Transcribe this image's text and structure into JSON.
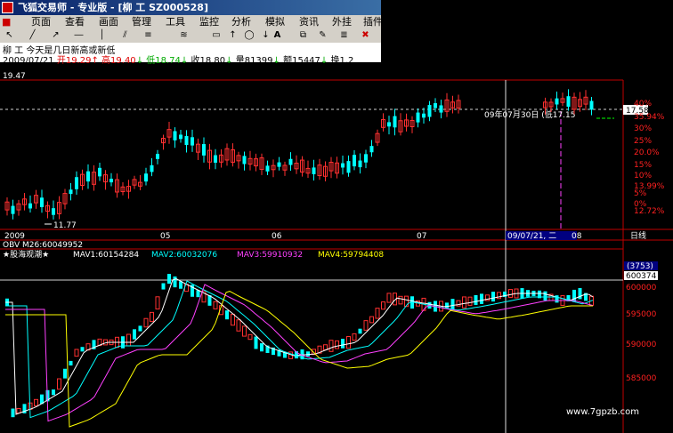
{
  "window": {
    "title": "飞狐交易师 - 专业版 - [柳  工 SZ000528]"
  },
  "menu": [
    "页面",
    "查看",
    "画面",
    "管理",
    "工具",
    "监控",
    "分析",
    "模拟",
    "资讯",
    "外挂",
    "插件"
  ],
  "toolbar_icons": [
    "arrow-icon",
    "line-icon",
    "ray-icon",
    "hline-icon",
    "vline-icon",
    "parallel-icon",
    "channel-icon",
    "rectangle-icon",
    "up-arrow-icon",
    "ellipse-icon",
    "down-arrow-icon",
    "text-icon",
    "copy-icon",
    "brush-icon",
    "fib-icon",
    "delete-icon"
  ],
  "stock": {
    "name_line": "柳   工  今天是几日新高或新低",
    "date": "2009/07/21",
    "open_label": "开19.29",
    "high_label": "高19.40",
    "low_label": "低18.74",
    "close_label": "收18.80",
    "vol_label": "量81399",
    "amt_label": "额15447",
    "turn_label": "换1.2"
  },
  "price_panel": {
    "top_price": "19.47",
    "low_price_label": "11.77",
    "crosshair_label": "09年07月30日 (低17.15",
    "current_price_tag": "17.58",
    "pct_labels": [
      "40%",
      "35.94%",
      "30%",
      "25%",
      "20.0%",
      "15%",
      "10%",
      "13.99%",
      "5%",
      "0%",
      "12.72%"
    ]
  },
  "time_axis": {
    "labels": [
      "2009",
      "05",
      "06",
      "07",
      "09/07/21, 二",
      "08"
    ],
    "right_label": "日线"
  },
  "obv_panel": {
    "header": "OBV M26:60049952",
    "title": "★股海观潮★",
    "mav1": "MAV1:60154284",
    "mav2": "MAV2:60032076",
    "mav3": "MAV3:59910932",
    "mav4": "MAV4:59794408",
    "value_tag": "(3753)",
    "value_tag2": "600374",
    "y_labels": [
      "600000",
      "595000",
      "590000",
      "585000"
    ]
  },
  "watermark": "www.7gpzb.com",
  "colors": {
    "up": "#ff3030",
    "down": "#00ffff",
    "mav1": "#ffffff",
    "mav2": "#00ffff",
    "mav3": "#ff40ff",
    "mav4": "#ffff00",
    "axis": "#ff2020"
  }
}
